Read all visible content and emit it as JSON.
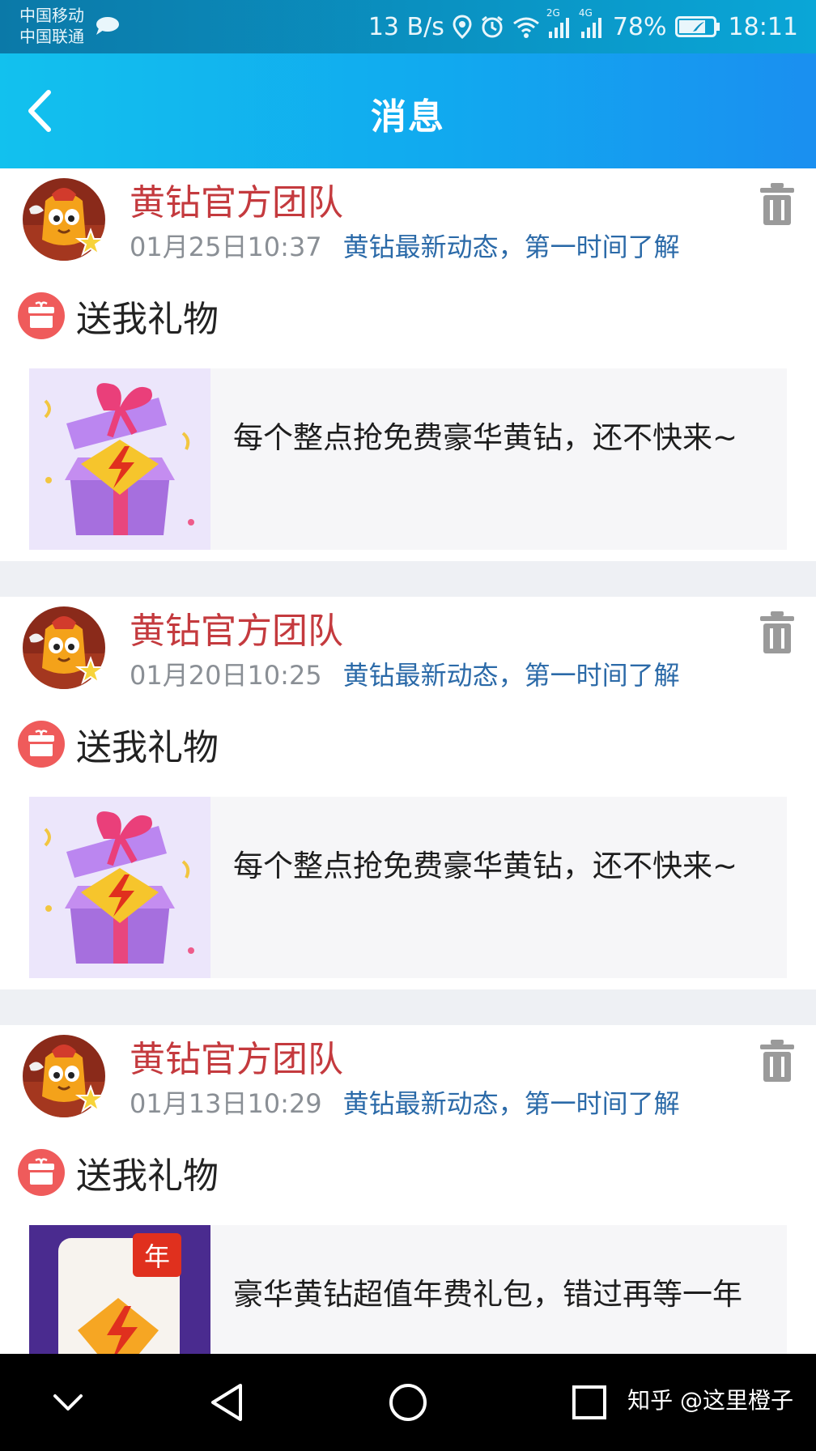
{
  "status_bar": {
    "carrier_1": "中国移动",
    "carrier_2": "中国联通",
    "net_speed": "13 B/s",
    "sig1_label": "2G",
    "sig2_label": "4G",
    "battery": "78%",
    "battery_level": 0.78,
    "time": "18:11"
  },
  "header": {
    "title": "消息"
  },
  "messages": [
    {
      "sender": "黄钻官方团队",
      "time": "01月25日10:37",
      "subtitle": "黄钻最新动态，第一时间了解",
      "category": "送我礼物",
      "promo_text": "每个整点抢免费豪华黄钻，还不快来~"
    },
    {
      "sender": "黄钻官方团队",
      "time": "01月20日10:25",
      "subtitle": "黄钻最新动态，第一时间了解",
      "category": "送我礼物",
      "promo_text": "每个整点抢免费豪华黄钻，还不快来~"
    },
    {
      "sender": "黄钻官方团队",
      "time": "01月13日10:29",
      "subtitle": "黄钻最新动态，第一时间了解",
      "category": "送我礼物",
      "promo_text": "豪华黄钻超值年费礼包，错过再等一年",
      "thumb_badge": "年"
    }
  ],
  "watermark": "知乎 @这里橙子",
  "colors": {
    "header_start": "#12c1ee",
    "header_end": "#1a8ff0",
    "sender": "#c43a3e",
    "subtitle": "#2b6aa8",
    "gift_badge": "#ef5b5b"
  },
  "icons": {
    "back": "chevron-left-icon",
    "delete": "trash-icon",
    "gift": "gift-icon",
    "nav": [
      "chevron-down-icon",
      "back-triangle-icon",
      "home-circle-icon",
      "recents-square-icon"
    ]
  }
}
